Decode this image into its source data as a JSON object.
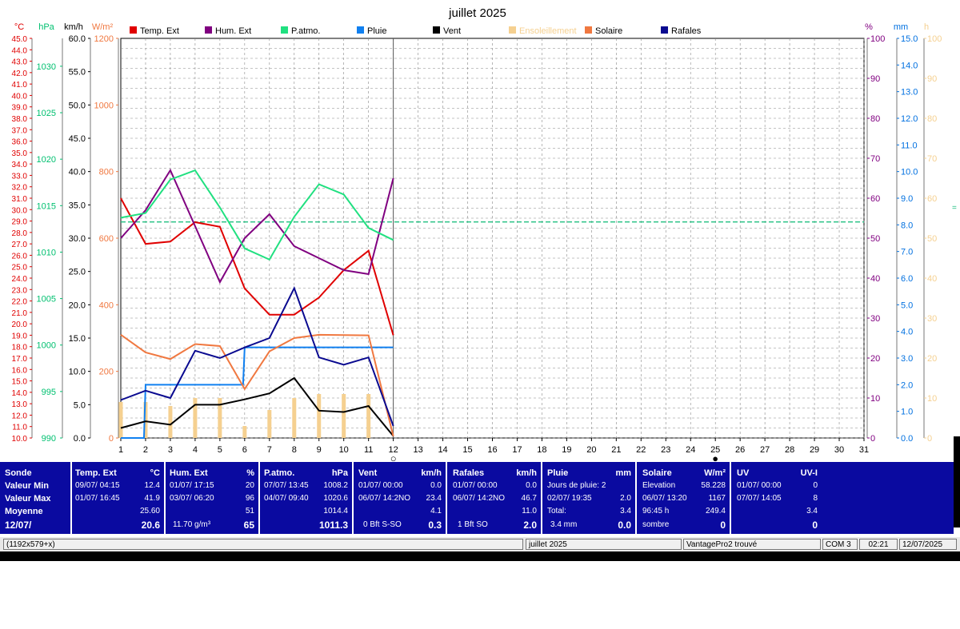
{
  "chart_data": {
    "type": "line",
    "title": "juillet 2025",
    "x": [
      1,
      2,
      3,
      4,
      5,
      6,
      7,
      8,
      9,
      10,
      11,
      12
    ],
    "x_ticks": [
      "1",
      "2",
      "3",
      "4",
      "5",
      "6",
      "7",
      "8",
      "9",
      "10",
      "11",
      "12",
      "13",
      "14",
      "15",
      "16",
      "17",
      "18",
      "19",
      "20",
      "21",
      "22",
      "23",
      "24",
      "25",
      "26",
      "27",
      "28",
      "29",
      "30",
      "31"
    ],
    "xlim": [
      1,
      31
    ],
    "grid": true,
    "axes": {
      "temp": {
        "unit": "°C",
        "range": [
          10,
          45
        ],
        "color": "#e00000",
        "ticks": [
          "45.0",
          "44.0",
          "43.0",
          "42.0",
          "41.0",
          "40.0",
          "39.0",
          "38.0",
          "37.0",
          "36.0",
          "35.0",
          "34.0",
          "33.0",
          "32.0",
          "31.0",
          "30.0",
          "29.0",
          "28.0",
          "27.0",
          "26.0",
          "25.0",
          "24.0",
          "23.0",
          "22.0",
          "21.0",
          "20.0",
          "19.0",
          "18.0",
          "17.0",
          "16.0",
          "15.0",
          "14.0",
          "13.0",
          "12.0",
          "11.0",
          "10.0"
        ]
      },
      "pressure": {
        "unit": "hPa",
        "range": [
          990,
          1033
        ],
        "color": "#00c070",
        "ticks": [
          "1030",
          "1025",
          "1020",
          "1015",
          "1010",
          "1005",
          "1000",
          "995",
          "990"
        ]
      },
      "wind": {
        "unit": "km/h",
        "range": [
          0,
          60
        ],
        "color": "#000000",
        "ticks": [
          "60.0",
          "55.0",
          "50.0",
          "45.0",
          "40.0",
          "35.0",
          "30.0",
          "25.0",
          "20.0",
          "15.0",
          "10.0",
          "5.0",
          "0.0"
        ]
      },
      "solar": {
        "unit": "W/m²",
        "range": [
          0,
          1200
        ],
        "color": "#f07840",
        "ticks": [
          "1200",
          "1000",
          "800",
          "600",
          "400",
          "200",
          "0"
        ]
      },
      "humidity": {
        "unit": "%",
        "range": [
          0,
          100
        ],
        "color": "#800080",
        "ticks": [
          "100",
          "90",
          "80",
          "70",
          "60",
          "50",
          "40",
          "30",
          "20",
          "10",
          "0"
        ]
      },
      "rain": {
        "unit": "mm",
        "range": [
          0,
          15
        ],
        "color": "#0070e0",
        "ticks": [
          "15.0",
          "14.0",
          "13.0",
          "12.0",
          "11.0",
          "10.0",
          "9.0",
          "8.0",
          "7.0",
          "6.0",
          "5.0",
          "4.0",
          "3.0",
          "2.0",
          "1.0",
          "0.0"
        ]
      },
      "sun": {
        "unit": "h",
        "range": [
          0,
          100
        ],
        "color": "#f5d090",
        "ticks": [
          "100",
          "90",
          "80",
          "70",
          "60",
          "50",
          "40",
          "30",
          "20",
          "10",
          "0"
        ]
      }
    },
    "series": [
      {
        "name": "Temp. Ext",
        "axis": "temp",
        "color": "#e00000",
        "values": [
          31.0,
          27.0,
          27.2,
          28.9,
          28.5,
          23.1,
          20.8,
          20.8,
          22.3,
          24.7,
          26.4,
          19.0
        ]
      },
      {
        "name": "Hum. Ext",
        "axis": "humidity",
        "color": "#800080",
        "values": [
          50,
          57,
          67,
          53,
          39,
          50,
          56,
          48,
          45,
          42,
          41,
          65
        ]
      },
      {
        "name": "P.atmo.",
        "axis": "pressure",
        "color": "#20e080",
        "values": [
          1013.7,
          1014.2,
          1017.8,
          1018.8,
          1014.8,
          1010.4,
          1009.2,
          1013.8,
          1017.3,
          1016.2,
          1012.6,
          1011.3
        ]
      },
      {
        "name": "Pluie",
        "axis": "rain",
        "color": "#1080f0",
        "values": [
          0.0,
          2.0,
          2.0,
          2.0,
          2.0,
          3.4,
          3.4,
          3.4,
          3.4,
          3.4,
          3.4,
          3.4
        ]
      },
      {
        "name": "Vent",
        "axis": "wind",
        "color": "#000000",
        "values": [
          1.5,
          2.5,
          2.0,
          5.0,
          5.0,
          5.8,
          6.7,
          9.0,
          4.1,
          3.9,
          4.8,
          0.3
        ]
      },
      {
        "name": "Ensoleillement",
        "axis": "sun",
        "color": "#f5d090",
        "kind": "bar",
        "values": [
          9,
          9,
          8,
          10,
          10,
          3,
          7,
          10,
          11,
          11,
          11,
          0
        ]
      },
      {
        "name": "Solaire",
        "axis": "solar",
        "color": "#f07840",
        "values": [
          310,
          257,
          237,
          282,
          276,
          147,
          260,
          300,
          310,
          309,
          308,
          5
        ]
      },
      {
        "name": "Rafales",
        "axis": "wind",
        "color": "#0a0a90",
        "values": [
          5.7,
          7.1,
          6.0,
          13.1,
          12.0,
          13.6,
          15.0,
          22.5,
          12.1,
          11.0,
          12.1,
          1.8
        ]
      }
    ],
    "reference_line": {
      "axis": "pressure",
      "value": 1013.25,
      "color": "#20c080",
      "style": "dashed"
    },
    "markers": [
      {
        "x": 12,
        "symbol": "○",
        "label": "new-moon-marker"
      },
      {
        "x": 25,
        "symbol": "●",
        "label": "full-moon-marker"
      }
    ],
    "right_edge_mark": "="
  },
  "stats": {
    "row_labels": [
      "Sonde",
      "Valeur Min",
      "Valeur Max",
      "Moyenne",
      "12/07/"
    ],
    "temp": {
      "title": "Temp. Ext",
      "unit": "°C",
      "min_date": "09/07/  04:15",
      "min": "12.4",
      "max_date": "01/07/  16:45",
      "max": "41.9",
      "avg": "25.60",
      "current": "20.6"
    },
    "hum": {
      "title": "Hum. Ext",
      "unit": "%",
      "min_date": "01/07/  17:15",
      "min": "20",
      "max_date": "03/07/  06:20",
      "max": "96",
      "avg": "51",
      "abs": "11.70 g/m³",
      "current": "65"
    },
    "press": {
      "title": "P.atmo.",
      "unit": "hPa",
      "min_date": "07/07/  13:45",
      "min": "1008.2",
      "max_date": "04/07/  09:40",
      "max": "1020.6",
      "avg": "1014.4",
      "current": "1011.3"
    },
    "wind": {
      "title": "Vent",
      "unit": "km/h",
      "min_date": "01/07/  00:00",
      "min": "0.0",
      "max_date": "06/07/  14:2NO",
      "max": "23.4",
      "avg": "4.1",
      "beaufort": "0 Bft S-SO",
      "current": "0.3"
    },
    "gust": {
      "title": "Rafales",
      "unit": "km/h",
      "min_date": "01/07/  00:00",
      "min": "0.0",
      "max_date": "06/07/  14:2NO",
      "max": "46.7",
      "avg": "11.0",
      "beaufort": "1 Bft SO",
      "current": "2.0"
    },
    "rain": {
      "title": "Pluie",
      "unit": "mm",
      "days": "Jours de pluie: 2",
      "max_date": "02/07/  19:35",
      "max": "2.0",
      "total_label": "Total:",
      "total": "3.4",
      "current_label": "3.4 mm",
      "current": "0.0"
    },
    "solar": {
      "title": "Solaire",
      "unit": "W/m²",
      "elev_label": "Elevation",
      "elev": "58.228",
      "max_date": "06/07/  13:20",
      "max": "1167",
      "hours_label": "96:45 h",
      "hours": "249.4",
      "cond": "sombre",
      "current": "0"
    },
    "uv": {
      "title": "UV",
      "unit": "UV-I",
      "min_date": "01/07/  00:00",
      "min": "0",
      "max_date": "07/07/  14:05",
      "max": "8",
      "avg": "3.4",
      "current": "0"
    }
  },
  "statusbar": {
    "size": "(1192x579+x)",
    "month": "juillet 2025",
    "station": "VantagePro2 trouvé",
    "port": "COM 3",
    "time": "02:21",
    "date": "12/07/2025"
  }
}
